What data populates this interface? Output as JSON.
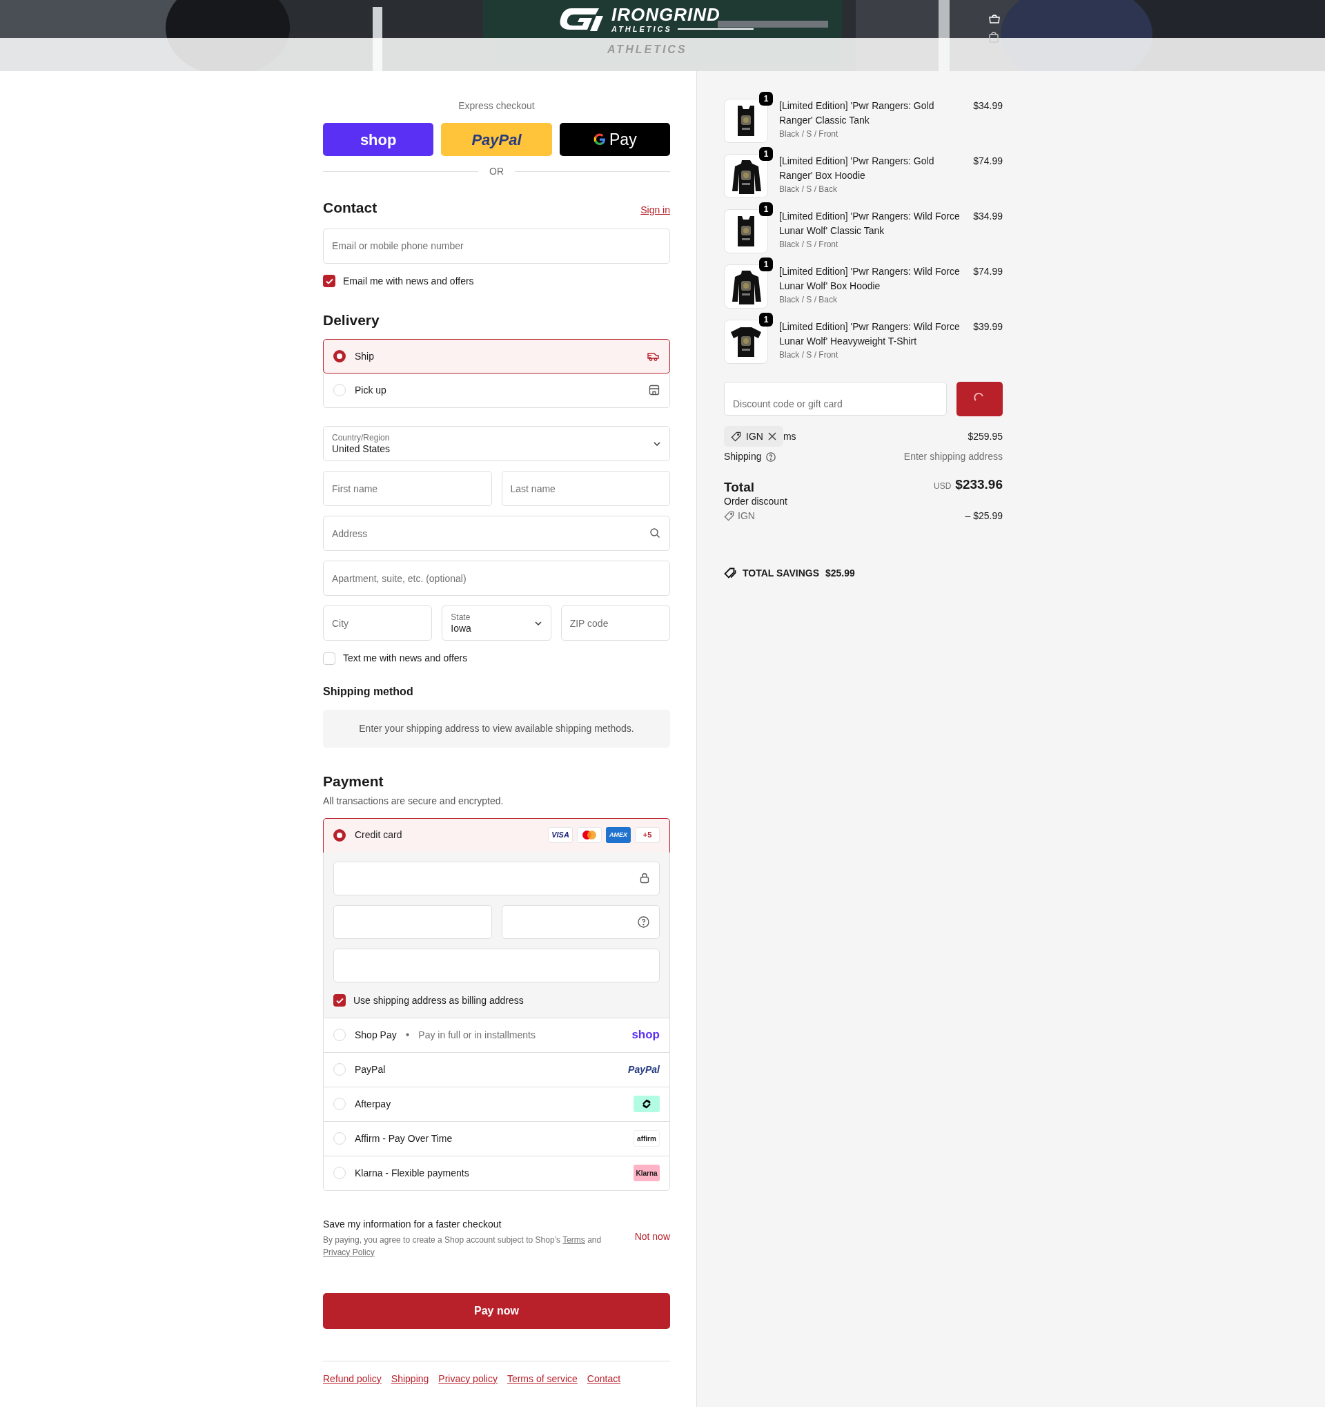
{
  "header": {
    "brand": "IRONGRIND",
    "tagline": "ATHLETICS",
    "ghost_tagline": "ATHLETICS"
  },
  "express": {
    "title": "Express checkout",
    "divider": "OR",
    "buttons": [
      {
        "kind": "shop",
        "label": "shop"
      },
      {
        "kind": "paypal",
        "label": "PayPal"
      },
      {
        "kind": "gpay",
        "label": "Pay"
      }
    ]
  },
  "contact": {
    "title": "Contact",
    "sign_in": "Sign in",
    "email": {
      "placeholder": "Email or mobile phone number"
    },
    "news": {
      "label": "Email me with news and offers",
      "checked": true
    }
  },
  "delivery": {
    "title": "Delivery",
    "options": [
      {
        "label": "Ship",
        "kind": "truck",
        "selected": true
      },
      {
        "label": "Pick up",
        "kind": "store",
        "selected": false
      }
    ],
    "rows": [
      [
        {
          "kind": "select",
          "label": "Country/Region",
          "value": "United States"
        }
      ],
      [
        {
          "kind": "text",
          "placeholder": "First name"
        },
        {
          "kind": "text",
          "placeholder": "Last name"
        }
      ],
      [
        {
          "kind": "search",
          "placeholder": "Address"
        }
      ],
      [
        {
          "kind": "text",
          "placeholder": "Apartment, suite, etc. (optional)"
        }
      ],
      [
        {
          "kind": "text",
          "placeholder": "City"
        },
        {
          "kind": "select",
          "label": "State",
          "value": "Iowa"
        },
        {
          "kind": "text",
          "placeholder": "ZIP code"
        }
      ]
    ],
    "sms": {
      "label": "Text me with news and offers",
      "checked": false
    }
  },
  "shipping_method": {
    "title": "Shipping method",
    "note": "Enter your shipping address to view available shipping methods."
  },
  "payment": {
    "title": "Payment",
    "subtitle": "All transactions are secure and encrypted.",
    "methods": [
      {
        "kind": "card",
        "label": "Credit card",
        "selected": true,
        "brands": [
          {
            "kind": "visa",
            "label": "VISA"
          },
          {
            "kind": "mastercard"
          },
          {
            "kind": "amex",
            "label": "AMEX"
          },
          {
            "kind": "more",
            "label": "+5"
          }
        ]
      },
      {
        "kind": "shop",
        "label": "Shop Pay",
        "separator": "•",
        "note": "Pay in full or in installments",
        "logo": "shop",
        "selected": false
      },
      {
        "kind": "paypal",
        "label": "PayPal",
        "logo": "PayPal",
        "selected": false
      },
      {
        "kind": "afterpay",
        "label": "Afterpay",
        "selected": false
      },
      {
        "kind": "affirm",
        "label": "Affirm - Pay Over Time",
        "logo": "affirm",
        "selected": false
      },
      {
        "kind": "klarna",
        "label": "Klarna - Flexible payments",
        "logo": "Klarna",
        "selected": false
      }
    ],
    "card_fields": [
      [
        {
          "kind": "lock"
        }
      ],
      [
        {
          "kind": "plain"
        },
        {
          "kind": "help"
        }
      ],
      [
        {
          "kind": "plain"
        }
      ]
    ],
    "billing": {
      "label": "Use shipping address as billing address",
      "checked": true
    }
  },
  "save": {
    "title": "Save my information for a faster checkout",
    "text_before": "By paying, you agree to create a Shop account subject to Shop’s",
    "terms_link": "Terms",
    "text_middle": "and",
    "privacy_link": "Privacy Policy",
    "not_now": "Not now"
  },
  "pay_button": "Pay now",
  "footer_links": [
    "Refund policy",
    "Shipping",
    "Privacy policy",
    "Terms of service",
    "Contact"
  ],
  "summary": {
    "items": [
      {
        "kind": "tank",
        "quantity": "1",
        "title": "[Limited Edition] 'Pwr Rangers: Gold Ranger' Classic Tank",
        "variant": "Black / S / Front",
        "price": "$34.99"
      },
      {
        "kind": "hoodie",
        "quantity": "1",
        "title": "[Limited Edition] 'Pwr Rangers: Gold Ranger' Box Hoodie",
        "variant": "Black / S / Back",
        "price": "$74.99"
      },
      {
        "kind": "tank",
        "quantity": "1",
        "title": "[Limited Edition] 'Pwr Rangers: Wild Force Lunar Wolf' Classic Tank",
        "variant": "Black / S / Front",
        "price": "$34.99"
      },
      {
        "kind": "hoodie",
        "quantity": "1",
        "title": "[Limited Edition] 'Pwr Rangers: Wild Force Lunar Wolf' Box Hoodie",
        "variant": "Black / S / Back",
        "price": "$74.99"
      },
      {
        "kind": "tee",
        "quantity": "1",
        "title": "[Limited Edition] 'Pwr Rangers: Wild Force Lunar Wolf' Heavyweight T-Shirt",
        "variant": "Black / S / Front",
        "price": "$39.99"
      }
    ],
    "discount": {
      "placeholder": "Discount code or gift card"
    },
    "applied_code": "IGN",
    "subtotal": {
      "label": "ms",
      "value": "$259.95"
    },
    "shipping": {
      "label": "Shipping",
      "value": "Enter shipping address"
    },
    "total": {
      "label": "Total",
      "currency": "USD",
      "value": "$233.96"
    },
    "order_discount": {
      "label": "Order discount",
      "code": "IGN",
      "value": "– $25.99"
    },
    "savings": {
      "label": "TOTAL SAVINGS",
      "value": "$25.99"
    }
  }
}
